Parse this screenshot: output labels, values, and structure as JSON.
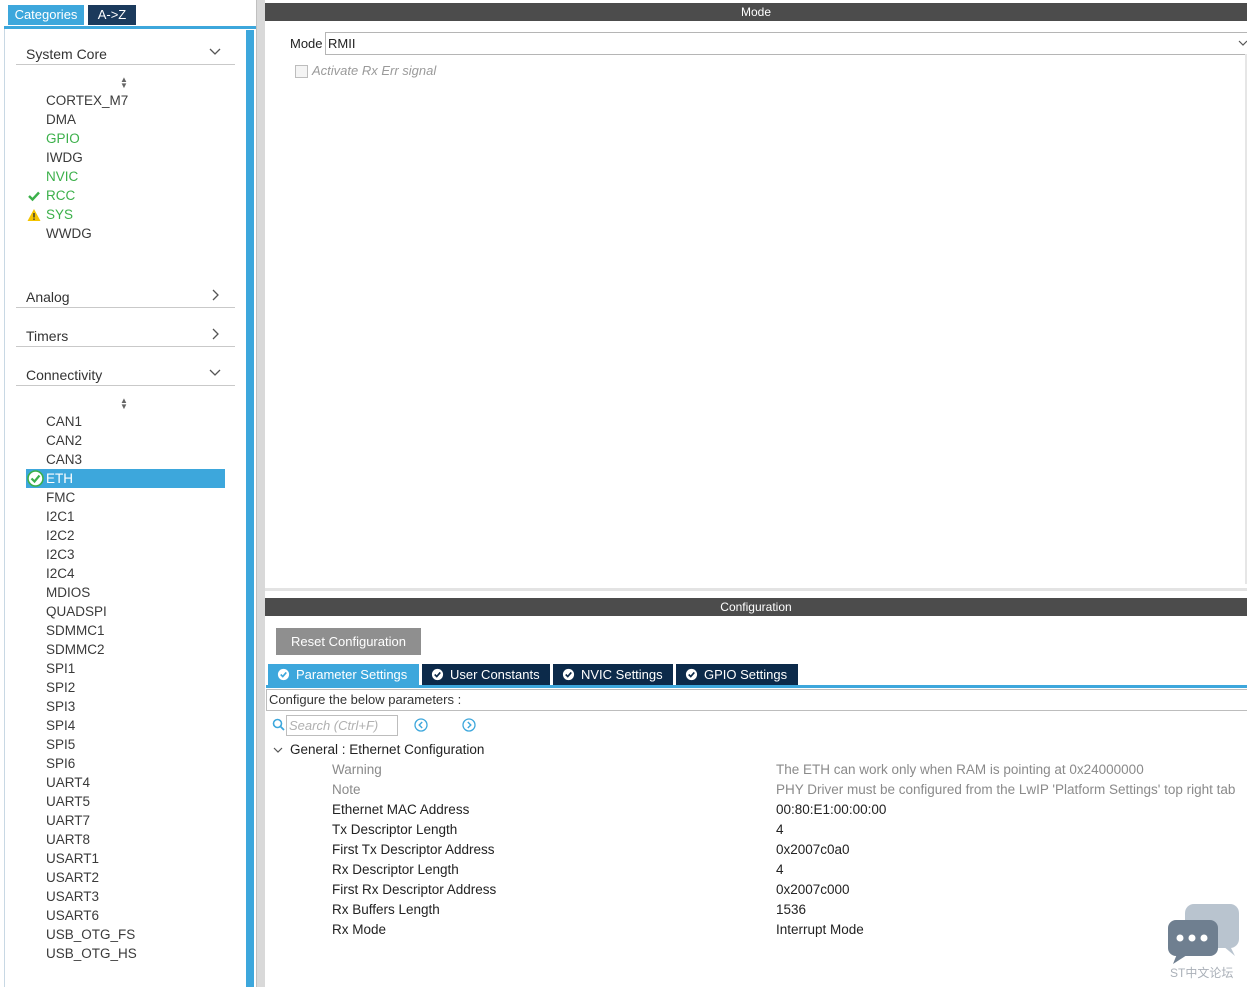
{
  "left_panel": {
    "tabs": {
      "categories": "Categories",
      "az": "A->Z"
    },
    "sections": {
      "system_core": "System Core",
      "analog": "Analog",
      "timers": "Timers",
      "connectivity": "Connectivity"
    },
    "system_core_items": [
      "CORTEX_M7",
      "DMA",
      "GPIO",
      "IWDG",
      "NVIC",
      "RCC",
      "SYS",
      "WWDG"
    ],
    "connectivity_items": [
      "CAN1",
      "CAN2",
      "CAN3",
      "ETH",
      "FMC",
      "I2C1",
      "I2C2",
      "I2C3",
      "I2C4",
      "MDIOS",
      "QUADSPI",
      "SDMMC1",
      "SDMMC2",
      "SPI1",
      "SPI2",
      "SPI3",
      "SPI4",
      "SPI5",
      "SPI6",
      "UART4",
      "UART5",
      "UART7",
      "UART8",
      "USART1",
      "USART2",
      "USART3",
      "USART6",
      "USB_OTG_FS",
      "USB_OTG_HS"
    ]
  },
  "mode_panel": {
    "header": "Mode",
    "mode_label": "Mode",
    "mode_value": "RMII",
    "checkbox_label": "Activate Rx Err signal"
  },
  "config_panel": {
    "header": "Configuration",
    "reset_button": "Reset Configuration",
    "tabs": [
      "Parameter Settings",
      "User Constants",
      "NVIC Settings",
      "GPIO Settings"
    ],
    "configure_label": "Configure the below parameters :",
    "search_placeholder": "Search (Ctrl+F)",
    "group_label": "General : Ethernet Configuration",
    "params": [
      {
        "name": "Warning",
        "value": "The ETH can work only when RAM is pointing at 0x24000000"
      },
      {
        "name": "Note",
        "value": "PHY Driver must be configured from the LwIP 'Platform Settings' top right tab"
      },
      {
        "name": "Ethernet MAC Address",
        "value": "00:80:E1:00:00:00"
      },
      {
        "name": "Tx Descriptor Length",
        "value": "4"
      },
      {
        "name": "First Tx Descriptor Address",
        "value": "0x2007c0a0"
      },
      {
        "name": "Rx Descriptor Length",
        "value": "4"
      },
      {
        "name": "First Rx Descriptor Address",
        "value": "0x2007c000"
      },
      {
        "name": "Rx Buffers Length",
        "value": "1536"
      },
      {
        "name": "Rx Mode",
        "value": "Interrupt Mode"
      }
    ]
  },
  "watermark": "ST中文论坛",
  "colors": {
    "accent": "#3da7dc",
    "navy": "#0c2a4a",
    "green": "#3bb04a",
    "warning": "#f4c400",
    "header": "#4c4c4c"
  }
}
